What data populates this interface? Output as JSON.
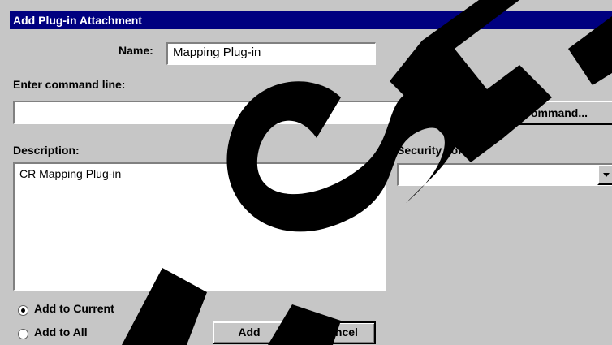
{
  "dialog": {
    "title": "Add Plug-in Attachment",
    "name_label": "Name:",
    "name_value": "Mapping Plug-in",
    "command_label": "Enter command line:",
    "command_value": "",
    "build_command_button": "Build Command...",
    "description_label": "Description:",
    "description_value": "CR Mapping Plug-in",
    "security_token_label": "Security Token:",
    "security_token_value": "",
    "radio_add_current": "Add to Current",
    "radio_add_all": "Add to All",
    "add_button": "Add",
    "cancel_button": "Cancel",
    "selected_radio": "Add to Current"
  },
  "colors": {
    "titlebar": "#000080",
    "background": "#c6c6c6",
    "watermark": "#000000"
  },
  "watermark_text": "REVERSE"
}
